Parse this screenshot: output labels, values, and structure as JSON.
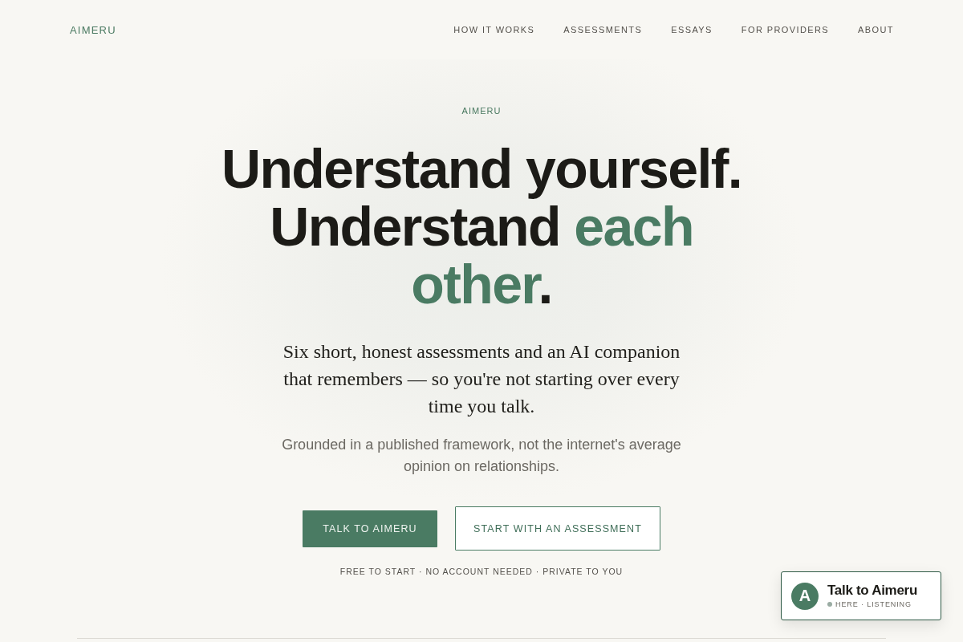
{
  "nav": {
    "logo": "AIMERU",
    "links": [
      {
        "label": "HOW IT WORKS"
      },
      {
        "label": "ASSESSMENTS"
      },
      {
        "label": "ESSAYS"
      },
      {
        "label": "FOR PROVIDERS"
      },
      {
        "label": "ABOUT"
      }
    ]
  },
  "hero": {
    "eyebrow": "AIMERU",
    "headline": [
      {
        "text": "Understand yourself. Understand ",
        "accent": false
      },
      {
        "text": "each other",
        "accent": true
      },
      {
        "text": ".",
        "accent": false
      }
    ],
    "lead": "Six short, honest assessments and an AI companion that remembers — so you're not starting over every time you talk.",
    "subtext": "Grounded in a published framework, not the internet's average opinion on relationships.",
    "buttons": [
      {
        "label": "TALK TO AIMERU",
        "kind": "primary"
      },
      {
        "label": "START WITH AN ASSESSMENT",
        "kind": "secondary"
      }
    ],
    "note": "FREE TO START · NO ACCOUNT NEEDED · PRIVATE TO YOU"
  },
  "chat_widget": {
    "avatar": "A",
    "title": "Talk to Aimeru",
    "status": "HERE · LISTENING"
  }
}
